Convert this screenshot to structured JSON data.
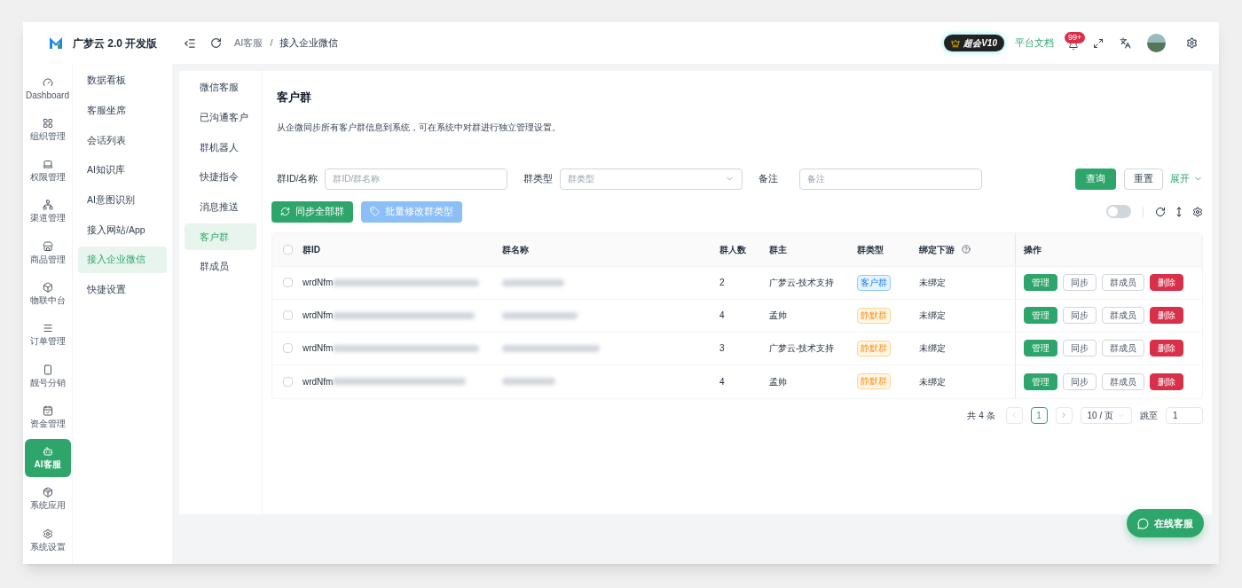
{
  "brand": {
    "title": "广梦云 2.0 开发版"
  },
  "top_bar": {
    "breadcrumb": [
      "AI客服",
      "接入企业微信"
    ],
    "breadcrumb_separator": "/",
    "vip_badge": "超会V10",
    "docs_link": "平台文档",
    "notification_count": "99+"
  },
  "rail": [
    {
      "label": "Dashboard",
      "selected": false
    },
    {
      "label": "组织管理",
      "selected": false
    },
    {
      "label": "权限管理",
      "selected": false
    },
    {
      "label": "渠道管理",
      "selected": false
    },
    {
      "label": "商品管理",
      "selected": false
    },
    {
      "label": "物联中台",
      "selected": false
    },
    {
      "label": "订单管理",
      "selected": false
    },
    {
      "label": "靓号分销",
      "selected": false
    },
    {
      "label": "资金管理",
      "selected": false
    },
    {
      "label": "AI客服",
      "selected": true
    },
    {
      "label": "系统应用",
      "selected": false
    },
    {
      "label": "系统设置",
      "selected": false
    }
  ],
  "menu": [
    {
      "label": "数据看板",
      "selected": false
    },
    {
      "label": "客服坐席",
      "selected": false
    },
    {
      "label": "会话列表",
      "selected": false
    },
    {
      "label": "AI知识库",
      "selected": false
    },
    {
      "label": "AI意图识别",
      "selected": false
    },
    {
      "label": "接入网站/App",
      "selected": false
    },
    {
      "label": "接入企业微信",
      "selected": true
    },
    {
      "label": "快捷设置",
      "selected": false
    }
  ],
  "submenu": [
    {
      "label": "微信客服",
      "selected": false
    },
    {
      "label": "已沟通客户",
      "selected": false
    },
    {
      "label": "群机器人",
      "selected": false
    },
    {
      "label": "快捷指令",
      "selected": false
    },
    {
      "label": "消息推送",
      "selected": false
    },
    {
      "label": "客户群",
      "selected": true
    },
    {
      "label": "群成员",
      "selected": false
    }
  ],
  "page": {
    "title": "客户群",
    "description": "从企微同步所有客户群信息到系统，可在系统中对群进行独立管理设置。"
  },
  "filters": [
    {
      "label": "群ID/名称",
      "placeholder": "群ID/群名称",
      "kind": "text"
    },
    {
      "label": "群类型",
      "placeholder": "群类型",
      "kind": "select"
    },
    {
      "label": "备注",
      "placeholder": "备注",
      "kind": "text"
    }
  ],
  "filter_buttons": {
    "query": "查询",
    "reset": "重置",
    "expand": "展开"
  },
  "toolbar": {
    "sync_all": {
      "label": "同步全部群",
      "disabled": false
    },
    "batch_edit": {
      "label": "批量修改群类型",
      "disabled": true
    },
    "switch_on": false
  },
  "table": {
    "all_checked": false,
    "columns": [
      "群ID",
      "群名称",
      "群人数",
      "群主",
      "群类型",
      "绑定下游",
      "操作"
    ],
    "rows": [
      {
        "checked": false,
        "id": "wrdNfm",
        "members": "2",
        "owner": "广梦云-技术支持",
        "type": {
          "label": "客户群",
          "kind": "customer"
        },
        "binding": "未绑定",
        "actions": [
          "管理",
          "同步",
          "群成员",
          "删除"
        ]
      },
      {
        "checked": false,
        "id": "wrdNfm",
        "members": "4",
        "owner": "孟帅",
        "type": {
          "label": "静默群",
          "kind": "silent"
        },
        "binding": "未绑定",
        "actions": [
          "管理",
          "同步",
          "群成员",
          "删除"
        ]
      },
      {
        "checked": false,
        "id": "wrdNfm",
        "members": "3",
        "owner": "广梦云-技术支持",
        "type": {
          "label": "静默群",
          "kind": "silent"
        },
        "binding": "未绑定",
        "actions": [
          "管理",
          "同步",
          "群成员",
          "删除"
        ]
      },
      {
        "checked": false,
        "id": "wrdNfm",
        "members": "4",
        "owner": "孟帅",
        "type": {
          "label": "静默群",
          "kind": "silent"
        },
        "binding": "未绑定",
        "actions": [
          "管理",
          "同步",
          "群成员",
          "删除"
        ]
      }
    ]
  },
  "pagination": {
    "total": "共 4 条",
    "pages": [
      {
        "label": "1",
        "selected": true
      }
    ],
    "page_size": "10 / 页",
    "jump_label": "跳至",
    "jump_value": "1"
  },
  "chat_button": "在线客服"
}
